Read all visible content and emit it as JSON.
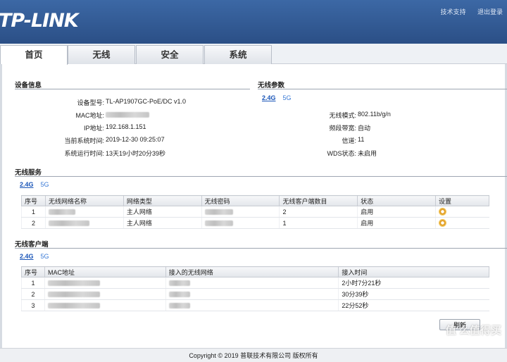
{
  "header": {
    "logo": "TP-LINK",
    "tech_support": "技术支持",
    "logout": "退出登录"
  },
  "tabs": [
    {
      "label": "首页",
      "active": true
    },
    {
      "label": "无线"
    },
    {
      "label": "安全"
    },
    {
      "label": "系统"
    }
  ],
  "device_info": {
    "title": "设备信息",
    "rows": [
      {
        "label": "设备型号:",
        "value": "TL-AP1907GC-PoE/DC v1.0"
      },
      {
        "label": "MAC地址:",
        "value": ""
      },
      {
        "label": "IP地址:",
        "value": "192.168.1.151"
      },
      {
        "label": "当前系统时间:",
        "value": "2019-12-30 09:25:07"
      },
      {
        "label": "系统运行时间:",
        "value": "13天19小时20分39秒"
      }
    ]
  },
  "wireless_params": {
    "title": "无线参数",
    "band_on": "2.4G",
    "band_off": "5G",
    "rows": [
      {
        "label": "无线模式:",
        "value": "802.11b/g/n"
      },
      {
        "label": "频段带宽:",
        "value": "自动"
      },
      {
        "label": "信道:",
        "value": "11"
      },
      {
        "label": "WDS状态:",
        "value": "未启用"
      }
    ]
  },
  "wireless_service": {
    "title": "无线服务",
    "band_on": "2.4G",
    "band_off": "5G",
    "headers": [
      "序号",
      "无线网络名称",
      "网络类型",
      "无线密码",
      "无线客户端数目",
      "状态",
      "设置"
    ],
    "rows": [
      {
        "no": "1",
        "type": "主人网络",
        "clients": "2",
        "status": "启用"
      },
      {
        "no": "2",
        "type": "主人网络",
        "clients": "1",
        "status": "启用"
      }
    ]
  },
  "wireless_clients": {
    "title": "无线客户端",
    "band_on": "2.4G",
    "band_off": "5G",
    "headers": [
      "序号",
      "MAC地址",
      "接入的无线网络",
      "接入时间"
    ],
    "rows": [
      {
        "no": "1",
        "time": "2小时7分21秒"
      },
      {
        "no": "2",
        "time": "30分39秒"
      },
      {
        "no": "3",
        "time": "22分52秒"
      }
    ]
  },
  "refresh_label": "刷新",
  "footer": "Copyright © 2019 普联技术有限公司 版权所有",
  "watermark": "值 么值得买",
  "icons": {
    "settings": "gear-icon"
  },
  "colors": {
    "header": "#2f5891",
    "link": "#1a55b8"
  }
}
